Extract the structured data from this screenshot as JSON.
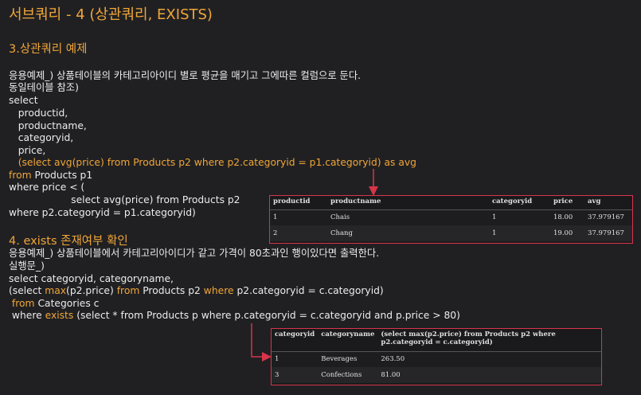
{
  "title": "서브쿼리 - 4 (상관쿼리, EXISTS)",
  "section3": {
    "heading": "3.상관쿼리 예제",
    "line1": "응용예제_) 상품테이블의 카테고리아이디 별로 평균을 매기고 그에따른 컬럼으로 둔다.",
    "line2": "동일테이블 참조)",
    "code": {
      "l1": "select",
      "l2": "   productid,",
      "l3": "   productname,",
      "l4": "   categoryid,",
      "l5": "   price,",
      "l6": "   (select avg(price) from Products p2 where p2.categoryid = p1.categoryid) as avg",
      "l7_kw": "from",
      "l7_rest": " Products p1",
      "l8": "where price < (",
      "l9": "                    select avg(price) from Products p2",
      "l10": "where p2.categoryid = p1.categoryid)"
    }
  },
  "section4": {
    "heading": "4. exists 존재여부 확인",
    "line1": "응용예제_) 상품테이블에서 카테고리아이디가 같고 가격이 80초과인 행이있다면 출력한다.",
    "line2": "실행문_)",
    "code": {
      "l1": "select categoryid, categoryname,",
      "l2_a": "(select ",
      "l2_kw1": "max",
      "l2_b": "(p2.price) ",
      "l2_kw2": "from",
      "l2_c": " Products p2 ",
      "l2_kw3": "where",
      "l2_d": " p2.categoryid = c.categoryid)",
      "l3_a": " ",
      "l3_kw": "from",
      "l3_b": " Categories c",
      "l4_a": " where ",
      "l4_kw": "exists",
      "l4_b": " (select * from Products p where p.categoryid = c.categoryid and p.price > 80)"
    }
  },
  "table1": {
    "headers": [
      "productid",
      "productname",
      "categoryid",
      "price",
      "avg"
    ],
    "rows": [
      [
        "1",
        "Chais",
        "1",
        "18.00",
        "37.979167"
      ],
      [
        "2",
        "Chang",
        "1",
        "19.00",
        "37.979167"
      ]
    ]
  },
  "table2": {
    "headers": [
      "categoryid",
      "categoryname",
      "(select max(p2.price) from Products p2 where p2.categoryid = c.categoryid)"
    ],
    "rows": [
      [
        "1",
        "Beverages",
        "263.50"
      ],
      [
        "3",
        "Confections",
        "81.00"
      ]
    ]
  },
  "colors": {
    "accent": "#f0a637",
    "arrow": "#d8344a",
    "background": "#202023"
  }
}
